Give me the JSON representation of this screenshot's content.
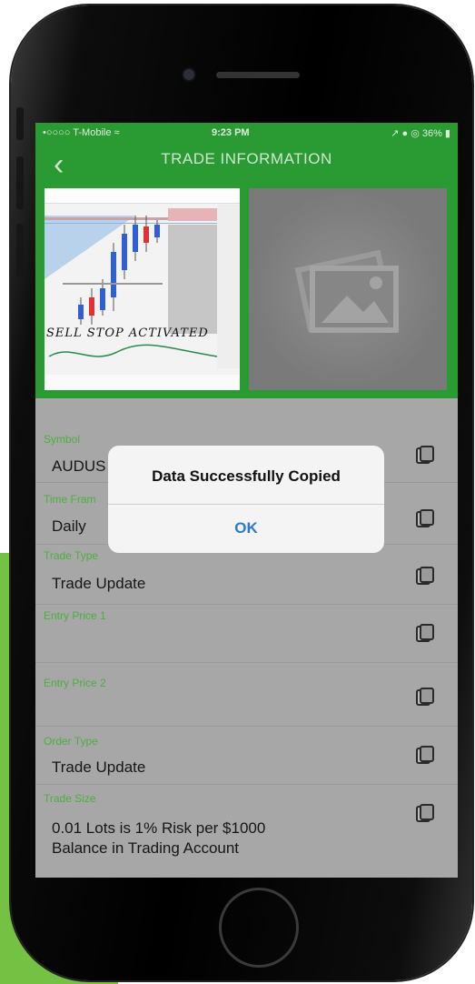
{
  "status_bar": {
    "carrier": "•○○○○ T-Mobile ≈",
    "time": "9:23 PM",
    "right": "↗ ● ◎ 36% ▮"
  },
  "header": {
    "title": "TRADE INFORMATION",
    "back_icon": "chevron-left-icon"
  },
  "images": {
    "chart_caption": "SELL STOP ACTIVATED",
    "placeholder_icon": "image-placeholder-icon"
  },
  "fields": [
    {
      "label": "Symbol",
      "value": "AUDUS"
    },
    {
      "label": "Time Fram",
      "value": "Daily"
    },
    {
      "label": "Trade Type",
      "value": "Trade Update"
    },
    {
      "label": "Entry Price 1",
      "value": ""
    },
    {
      "label": "Entry Price 2",
      "value": ""
    },
    {
      "label": "Order Type",
      "value": "Trade Update"
    },
    {
      "label": "Trade Size",
      "value": "0.01 Lots is 1% Risk per $1000",
      "value2": "Balance in Trading Account"
    }
  ],
  "dialog": {
    "title": "Data Successfully Copied",
    "ok_label": "OK"
  },
  "colors": {
    "nav_green": "#2a9a33",
    "label_green": "#4caf3f",
    "accent_bg_green": "#74c143",
    "ok_blue": "#2b79d2"
  }
}
